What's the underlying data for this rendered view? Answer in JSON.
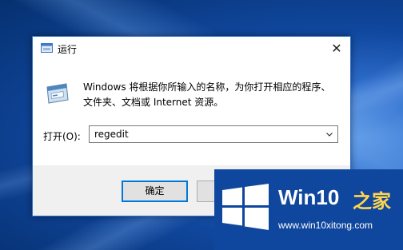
{
  "dialog": {
    "title": "运行",
    "close_label": "✕",
    "description": "Windows 将根据你所输入的名称，为你打开相应的程序、文件夹、文档或 Internet 资源。",
    "open_label": "打开(O):",
    "open_value": "regedit",
    "buttons": {
      "ok": "确定",
      "cancel": "",
      "browse": ""
    }
  },
  "watermark": {
    "title": "Win10",
    "title_suffix": "之家",
    "url": "www.win10xitong.com"
  },
  "colors": {
    "accent": "#0078d7",
    "desktop": "#0c3f8c",
    "watermark_highlight": "#ffd54f"
  },
  "icons": [
    "run-app-icon",
    "close-icon",
    "run-program-icon",
    "chevron-down-icon",
    "windows-logo-icon"
  ]
}
